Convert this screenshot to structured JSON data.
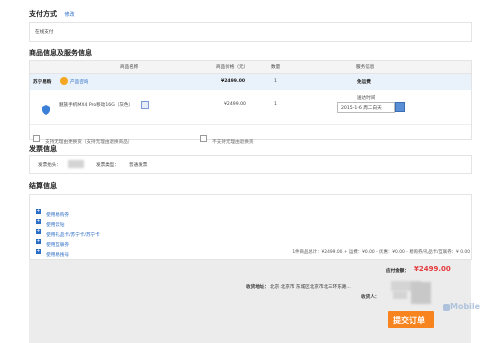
{
  "payment": {
    "title": "支付方式",
    "edit": "修改",
    "method": "在线支付"
  },
  "goods": {
    "title": "商品信息及服务信息",
    "columns": [
      "商品名称",
      "商品价格（元）",
      "数量",
      "服务信息"
    ],
    "shop": {
      "name": "苏宁易购",
      "tag": "产品咨询",
      "total": "¥2499.00",
      "qty": "1",
      "shipping": "免运费"
    },
    "item": {
      "name": "魅族手机MX4 Pro移动16G（灰色）",
      "price": "¥2499.00",
      "qty": "1",
      "delivery_label": "送达时间",
      "delivery_date": "2015-1-6 周二白天"
    },
    "opt1": "支持无理由更换货（支持无理由退换商品）",
    "opt2": "不支持无理由退换货"
  },
  "invoice": {
    "title": "发票信息",
    "header_label": "发票抬头：",
    "type_label": "发票类型：",
    "type_value": "普通发票"
  },
  "settle": {
    "title": "结算信息",
    "links": [
      "使用易购券",
      "使用云钻",
      "使用礼品卡/苏宁卡/苏宁卡",
      "使用互联券",
      "使用易搜号"
    ],
    "summary": "1件商品总计：¥2499.00 + 运费：¥0.00 - 优惠：¥0.00 - 易购券/礼品卡/互联券：¥ 0.00",
    "payable_label": "应付金额：",
    "payable_value": "¥2499.00",
    "address_label": "收货地址：",
    "address_value": "北京 北京市 东城区北京市北三环东路...",
    "receiver_label": "收货人：",
    "submit": "提交订单"
  },
  "watermark": "Mobile",
  "colors": {
    "accent": "#2a6cc4",
    "price": "#e4393c",
    "submit": "#f7841f"
  }
}
